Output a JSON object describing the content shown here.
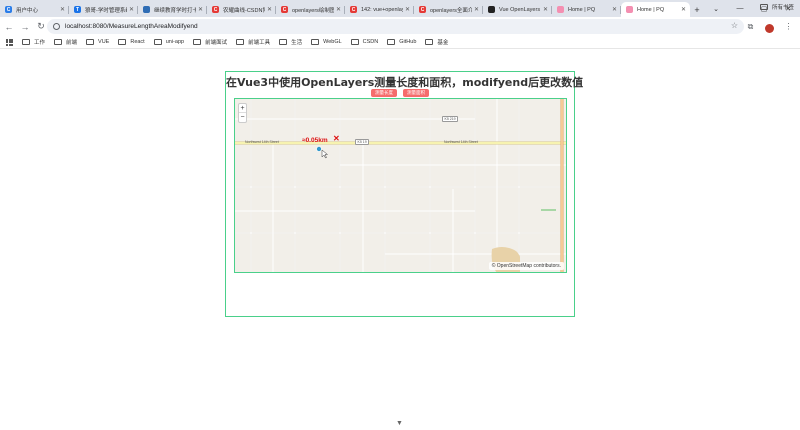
{
  "browser": {
    "tabs": [
      {
        "title": "用户中心",
        "favicon_color": "#2b7de9",
        "favicon_glyph": "C",
        "active": false
      },
      {
        "title": "狼哥-学时管理系统",
        "favicon_color": "#1a73e8",
        "favicon_glyph": "T",
        "active": false
      },
      {
        "title": "继续教育学时打卡",
        "favicon_color": "#2f6db5",
        "favicon_glyph": "",
        "active": false
      },
      {
        "title": "农耀曲线-CSDN博客",
        "favicon_color": "#e53935",
        "favicon_glyph": "C",
        "active": false
      },
      {
        "title": "openlayers绘制图形",
        "favicon_color": "#e53935",
        "favicon_glyph": "C",
        "active": false
      },
      {
        "title": "142: vue+openlayers",
        "favicon_color": "#e53935",
        "favicon_glyph": "C",
        "active": false
      },
      {
        "title": "openlayers全面介绍",
        "favicon_color": "#e53935",
        "favicon_glyph": "C",
        "active": false
      },
      {
        "title": "Vue OpenLayers",
        "favicon_color": "#222222",
        "favicon_glyph": "",
        "active": false
      },
      {
        "title": "Home | PQ",
        "favicon_color": "#f48fb1",
        "favicon_glyph": "",
        "active": false
      },
      {
        "title": "Home | PQ",
        "favicon_color": "#f48fb1",
        "favicon_glyph": "",
        "active": true
      }
    ],
    "url": "localhost:8080/MeasureLengthAreaModifyend",
    "bookmarks": [
      "工作",
      "前端",
      "VUE",
      "React",
      "uni-app",
      "前端面试",
      "前端工具",
      "生活",
      "WebGL",
      "CSDN",
      "GitHub",
      "基金"
    ],
    "all_bookmarks": "所有书签"
  },
  "page": {
    "title": "在Vue3中使用OpenLayers测量长度和面积，modifyend后更改数值",
    "buttons": {
      "measure_length": "测量长度",
      "measure_area": "测量面积"
    }
  },
  "map": {
    "zoom_in": "+",
    "zoom_out": "−",
    "measure_value": "≈0.05km",
    "measure_close": "✕",
    "attribution": "© OpenStreetMap contributors.",
    "road_labels": {
      "left": "Northwest 14th Street",
      "right": "Northwest 14th Street"
    },
    "shields": {
      "top": "K5 219",
      "mid": "K5 19"
    }
  },
  "colors": {
    "accent_button": "#f56c6c",
    "frame_border": "#4ad08a",
    "measure_text": "#dd1111"
  }
}
